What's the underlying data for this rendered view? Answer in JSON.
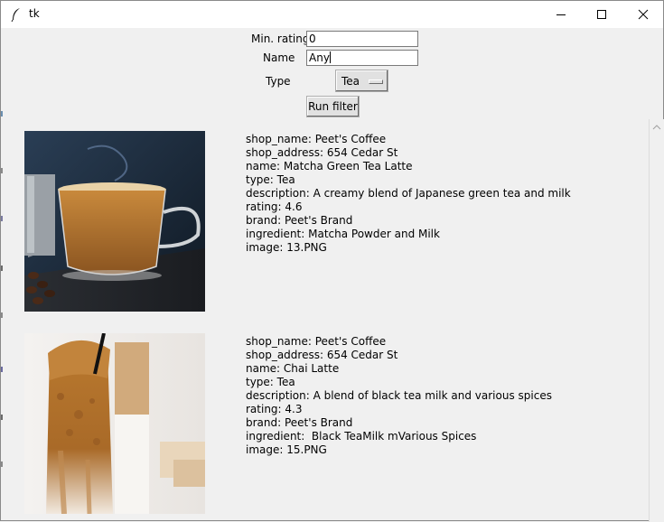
{
  "window": {
    "title": "tk"
  },
  "filters": {
    "min_rating_label": "Min. rating",
    "min_rating_value": "0",
    "name_label": "Name",
    "name_value": "Any",
    "type_label": "Type",
    "type_value": "Tea",
    "run_button": "Run filter"
  },
  "items": [
    {
      "image_icon": "matcha-latte-photo",
      "lines": [
        "shop_name: Peet's Coffee",
        "shop_address: 654 Cedar St",
        "name: Matcha Green Tea Latte",
        "type: Tea",
        "description: A creamy blend of Japanese green tea and milk",
        "rating: 4.6",
        "brand: Peet's Brand",
        "ingredient: Matcha Powder and Milk",
        "image: 13.PNG"
      ]
    },
    {
      "image_icon": "chai-latte-photo",
      "lines": [
        "shop_name: Peet's Coffee",
        "shop_address: 654 Cedar St",
        "name: Chai Latte",
        "type: Tea",
        "description: A blend of black tea milk and various spices",
        "rating: 4.3",
        "brand: Peet's Brand",
        "ingredient:  Black TeaMilk mVarious Spices",
        "image: 15.PNG"
      ]
    }
  ]
}
